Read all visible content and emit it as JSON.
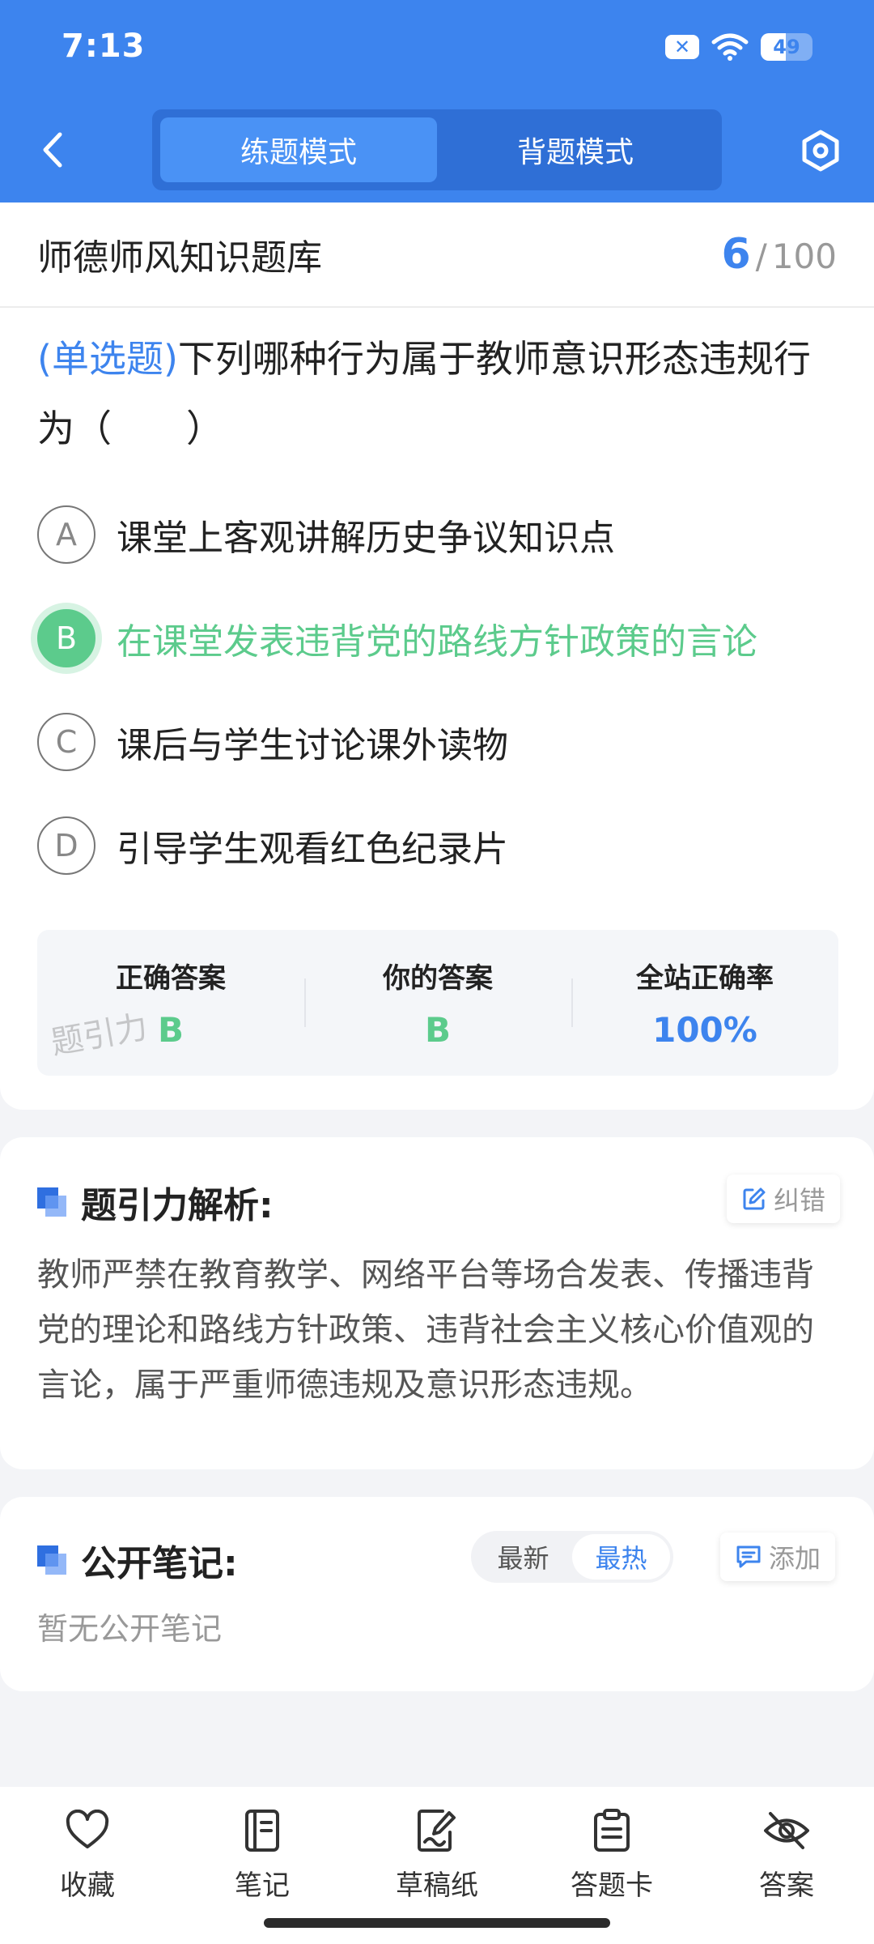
{
  "status_bar": {
    "time": "7:13",
    "battery_level": "49",
    "battery_fraction": 0.49,
    "notif_icon": "x-box-icon"
  },
  "header": {
    "modes": [
      {
        "label": "练题模式",
        "active": true
      },
      {
        "label": "背题模式",
        "active": false
      }
    ],
    "accent": "#3d84ee"
  },
  "bank": {
    "title": "师德师风知识题库",
    "current": "6",
    "separator": "/",
    "total": "100"
  },
  "question": {
    "type": "(单选题)",
    "text": "下列哪种行为属于教师意识形态违规行为（　　）",
    "options": [
      {
        "letter": "A",
        "text": "课堂上客观讲解历史争议知识点",
        "correct": false
      },
      {
        "letter": "B",
        "text": "在课堂发表违背党的路线方针政策的言论",
        "correct": true
      },
      {
        "letter": "C",
        "text": "课后与学生讨论课外读物",
        "correct": false
      },
      {
        "letter": "D",
        "text": "引导学生观看红色纪录片",
        "correct": false
      }
    ]
  },
  "stats": {
    "correct_label": "正确答案",
    "correct_value": "B",
    "yours_label": "你的答案",
    "yours_value": "B",
    "rate_label": "全站正确率",
    "rate_value": "100%",
    "watermark": "题引力"
  },
  "analysis": {
    "title": "题引力解析:",
    "report_label": "纠错",
    "text": "教师严禁在教育教学、网络平台等场合发表、传播违背党的理论和路线方针政策、违背社会主义核心价值观的言论，属于严重师德违规及意识形态违规。"
  },
  "notes": {
    "title": "公开笔记:",
    "sort": [
      {
        "label": "最新",
        "active": false
      },
      {
        "label": "最热",
        "active": true
      }
    ],
    "add_label": "添加",
    "empty_text": "暂无公开笔记"
  },
  "bottom_bar": {
    "items": [
      {
        "label": "收藏",
        "icon": "heart-icon"
      },
      {
        "label": "笔记",
        "icon": "notebook-icon"
      },
      {
        "label": "草稿纸",
        "icon": "draft-paper-icon"
      },
      {
        "label": "答题卡",
        "icon": "answer-sheet-icon"
      },
      {
        "label": "答案",
        "icon": "eye-off-icon"
      }
    ]
  }
}
